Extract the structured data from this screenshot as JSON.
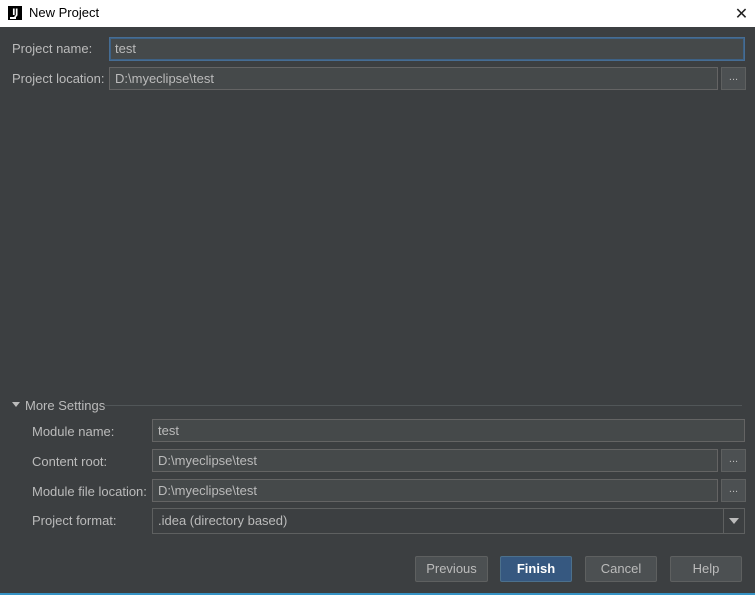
{
  "window": {
    "title": "New Project",
    "app_icon_text": "IJ",
    "close_glyph": "✕"
  },
  "project": {
    "name_label": "Project name:",
    "name_value": "test",
    "location_label": "Project location:",
    "location_value": "D:\\myeclipse\\test",
    "browse_label": "..."
  },
  "more_settings": {
    "header": "More Settings",
    "expanded": true,
    "module_name_label": "Module name:",
    "module_name_value": "test",
    "content_root_label": "Content root:",
    "content_root_value": "D:\\myeclipse\\test",
    "module_file_location_label": "Module file location:",
    "module_file_location_value": "D:\\myeclipse\\test",
    "project_format_label": "Project format:",
    "project_format_value": ".idea (directory based)",
    "browse_label": "..."
  },
  "buttons": {
    "previous": "Previous",
    "finish": "Finish",
    "cancel": "Cancel",
    "help": "Help"
  },
  "icons": {
    "close": "close-icon",
    "app": "intellij-icon",
    "expand": "triangle-down-icon",
    "dropdown": "chevron-down-icon"
  },
  "colors": {
    "background": "#3c3f41",
    "field_background": "#45494a",
    "primary_button": "#365880",
    "focus_border": "#466d94",
    "accent_line": "#3592c4"
  }
}
